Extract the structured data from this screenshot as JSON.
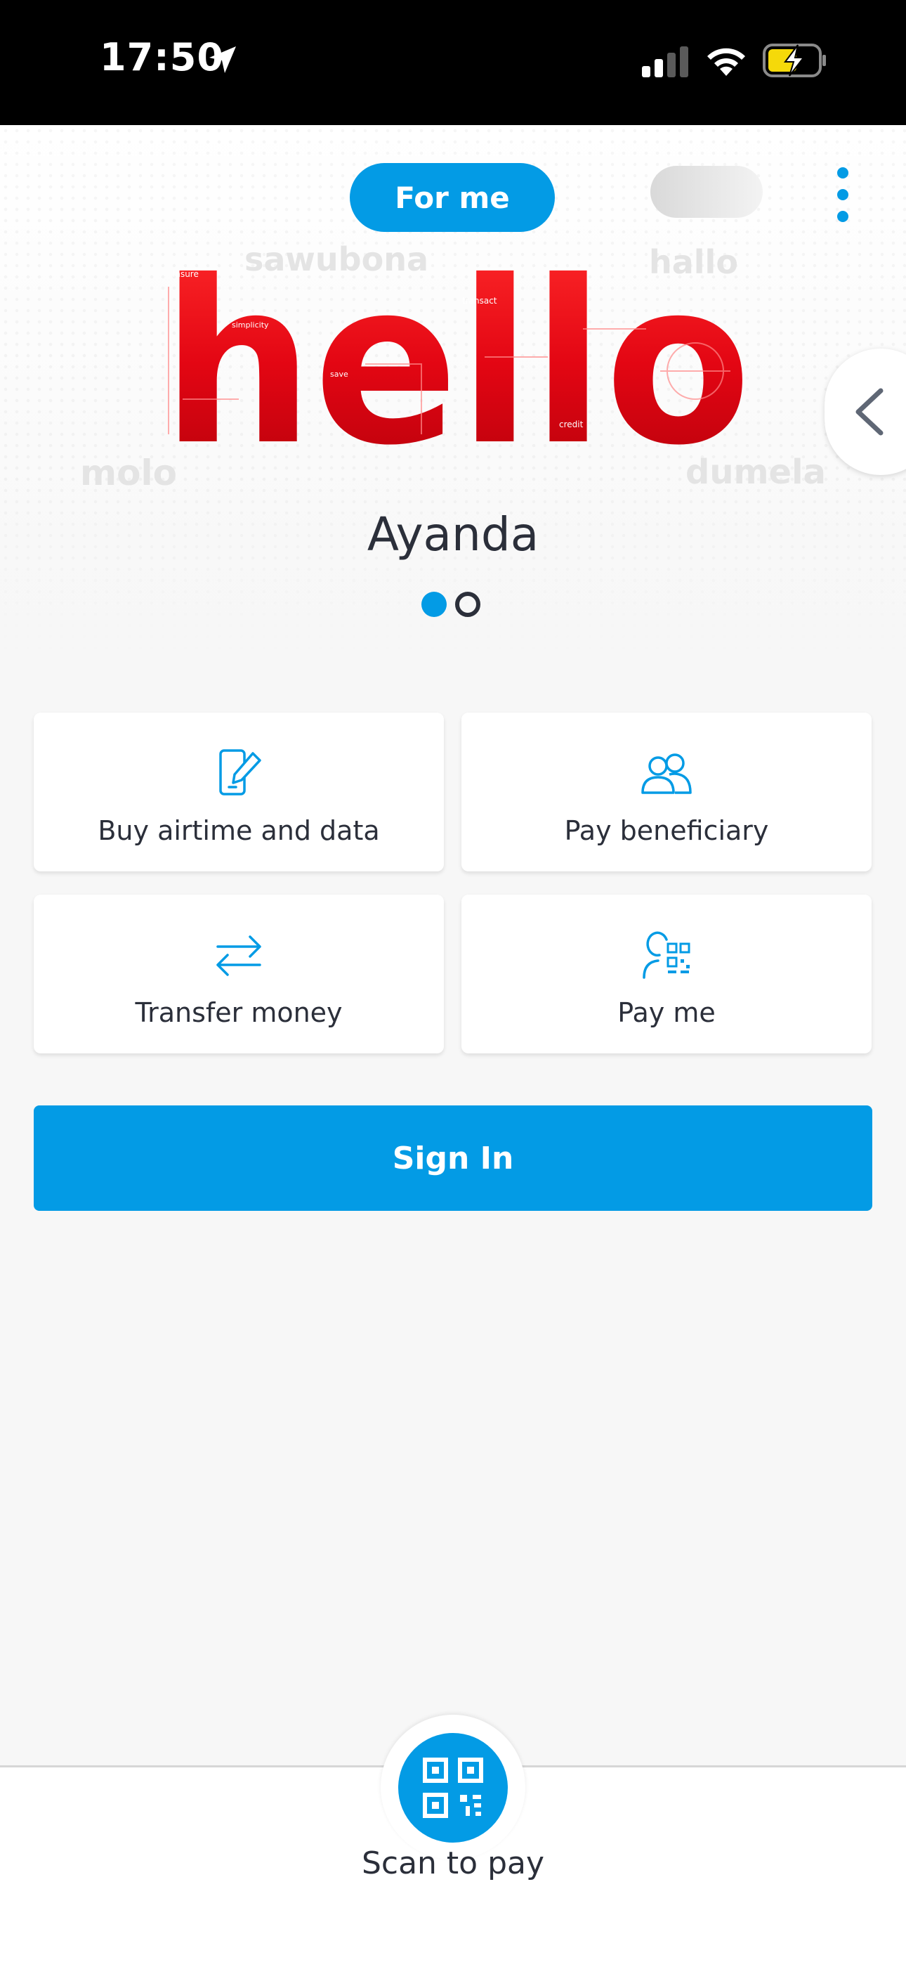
{
  "status_bar": {
    "time": "17:50"
  },
  "header": {
    "toggle_active": "For me",
    "menu_icon": "kebab-menu-icon"
  },
  "hero": {
    "greetings": [
      "sawubona",
      "hallo",
      "molo",
      "dumela"
    ],
    "hello_word": "hello",
    "hello_badges": [
      "insure",
      "simplicity",
      "save",
      "transact",
      "credit"
    ],
    "user_name": "Ayanda",
    "page_indicator": {
      "current": 1,
      "total": 2
    },
    "side_arrow_icon": "chevron-left-icon"
  },
  "quick_actions": [
    {
      "label": "Buy airtime and data",
      "icon": "phone-edit-icon"
    },
    {
      "label": "Pay beneficiary",
      "icon": "people-icon"
    },
    {
      "label": "Transfer money",
      "icon": "transfer-arrows-icon"
    },
    {
      "label": "Pay me",
      "icon": "person-qr-icon"
    }
  ],
  "sign_in": {
    "label": "Sign In"
  },
  "scan": {
    "label": "Scan to pay",
    "icon": "qr-code-icon"
  },
  "colors": {
    "accent": "#039be5",
    "brand_red": "#e30613",
    "text": "#2b2f3a",
    "background": "#f7f7f7"
  }
}
